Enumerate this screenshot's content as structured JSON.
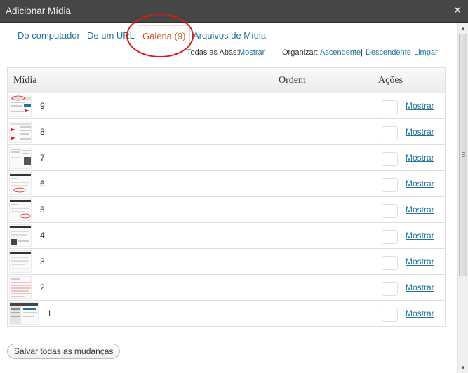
{
  "window": {
    "title": "Adicionar Mídia",
    "close_icon": "×"
  },
  "tabs": [
    {
      "label": "Do computador"
    },
    {
      "label": "De um URL"
    },
    {
      "label": "Galeria (9)",
      "active": true
    },
    {
      "label": "Arquivos de Mídia"
    }
  ],
  "filters": {
    "all_tabs_label": "Todas as Abas:",
    "show_link": "Mostrar",
    "sort_label": "Organizar:",
    "ascending": "Ascendente",
    "separator": "|",
    "descending": "Descendente",
    "clear": "Limpar"
  },
  "table": {
    "columns": [
      "Mídia",
      "Ordem",
      "Ações"
    ],
    "rows": [
      {
        "number": "9",
        "action": "Mostrar"
      },
      {
        "number": "8",
        "action": "Mostrar"
      },
      {
        "number": "7",
        "action": "Mostrar"
      },
      {
        "number": "6",
        "action": "Mostrar"
      },
      {
        "number": "5",
        "action": "Mostrar"
      },
      {
        "number": "4",
        "action": "Mostrar"
      },
      {
        "number": "3",
        "action": "Mostrar"
      },
      {
        "number": "2",
        "action": "Mostrar"
      },
      {
        "number": "1",
        "action": "Mostrar"
      }
    ]
  },
  "footer": {
    "save_all_label": "Salvar todas as mudanças"
  },
  "colors": {
    "link": "#21759b",
    "active_tab": "#d54e21",
    "highlight": "#e01818",
    "titlebar": "#464646"
  }
}
